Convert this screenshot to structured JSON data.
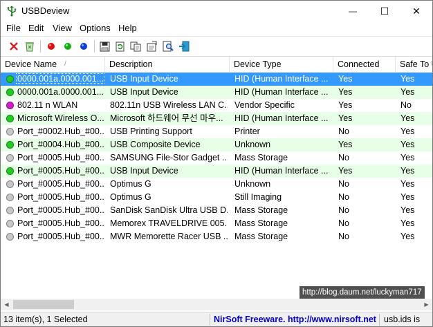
{
  "window": {
    "title": "USBDeview",
    "minimize_glyph": "—",
    "maximize_glyph": "☐",
    "close_glyph": "✕"
  },
  "menu": [
    "File",
    "Edit",
    "View",
    "Options",
    "Help"
  ],
  "toolbar": [
    {
      "icon": "delete-x-icon",
      "color": "#d42020"
    },
    {
      "icon": "recycle-bin-icon",
      "color": "#4c8a3c"
    },
    {
      "icon": "disconnect-red-icon",
      "color": "#e01010"
    },
    {
      "icon": "connect-green-icon",
      "color": "#10b010"
    },
    {
      "icon": "blue-dot-icon",
      "color": "#1040d0"
    },
    {
      "icon": "save-icon",
      "color": "#303030"
    },
    {
      "icon": "refresh-icon",
      "color": "#2a8a2a"
    },
    {
      "icon": "copy-icon",
      "color": "#404040"
    },
    {
      "icon": "properties-icon",
      "color": "#404040"
    },
    {
      "icon": "find-icon",
      "color": "#2050b0"
    },
    {
      "icon": "exit-icon",
      "color": "#1a7ab0"
    }
  ],
  "columns": [
    "Device Name",
    "Description",
    "Device Type",
    "Connected",
    "Safe To U"
  ],
  "sort_indicator": "/",
  "rows": [
    {
      "status": "green",
      "name": "0000.001a.0000.001....",
      "description": "USB Input Device",
      "type": "HID (Human Interface ...",
      "connected": "Yes",
      "safe": "Yes",
      "selected": true
    },
    {
      "status": "green",
      "name": "0000.001a.0000.001....",
      "description": "USB Input Device",
      "type": "HID (Human Interface ...",
      "connected": "Yes",
      "safe": "Yes"
    },
    {
      "status": "pink",
      "name": "802.11 n WLAN",
      "description": "802.11n USB Wireless LAN C...",
      "type": "Vendor Specific",
      "connected": "Yes",
      "safe": "No"
    },
    {
      "status": "green",
      "name": "Microsoft Wireless O...",
      "description": "Microsoft 하드웨어 무선 마우...",
      "type": "HID (Human Interface ...",
      "connected": "Yes",
      "safe": "Yes"
    },
    {
      "status": "gray",
      "name": "Port_#0002.Hub_#00...",
      "description": "USB Printing Support",
      "type": "Printer",
      "connected": "No",
      "safe": "Yes"
    },
    {
      "status": "green",
      "name": "Port_#0004.Hub_#00...",
      "description": "USB Composite Device",
      "type": "Unknown",
      "connected": "Yes",
      "safe": "Yes"
    },
    {
      "status": "gray",
      "name": "Port_#0005.Hub_#00...",
      "description": "SAMSUNG File-Stor Gadget ...",
      "type": "Mass Storage",
      "connected": "No",
      "safe": "Yes"
    },
    {
      "status": "green",
      "name": "Port_#0005.Hub_#00...",
      "description": "USB Input Device",
      "type": "HID (Human Interface ...",
      "connected": "Yes",
      "safe": "Yes"
    },
    {
      "status": "gray",
      "name": "Port_#0005.Hub_#00...",
      "description": "Optimus G",
      "type": "Unknown",
      "connected": "No",
      "safe": "Yes"
    },
    {
      "status": "gray",
      "name": "Port_#0005.Hub_#00...",
      "description": "Optimus G",
      "type": "Still Imaging",
      "connected": "No",
      "safe": "Yes"
    },
    {
      "status": "gray",
      "name": "Port_#0005.Hub_#00...",
      "description": "SanDisk SanDisk Ultra USB D...",
      "type": "Mass Storage",
      "connected": "No",
      "safe": "Yes"
    },
    {
      "status": "gray",
      "name": "Port_#0005.Hub_#00...",
      "description": "Memorex TRAVELDRIVE 005...",
      "type": "Mass Storage",
      "connected": "No",
      "safe": "Yes"
    },
    {
      "status": "gray",
      "name": "Port_#0005.Hub_#00...",
      "description": "MWR Memorette Racer USB ...",
      "type": "Mass Storage",
      "connected": "No",
      "safe": "Yes"
    }
  ],
  "status_colors": {
    "green": "#22cc22",
    "pink": "#cc22cc",
    "gray": "#c8c8c8"
  },
  "row_highlight_color": "#e6ffe6",
  "selection_color": "#3399ff",
  "watermark": "http://blog.daum.net/luckyman717",
  "scrollbar": {
    "left_arrow": "◀",
    "right_arrow": "▶"
  },
  "statusbar": {
    "count": "13 item(s), 1 Selected",
    "brand": "NirSoft Freeware.  http://www.nirsoft.net",
    "brand_color": "#0000cc",
    "usbids": "usb.ids is"
  }
}
